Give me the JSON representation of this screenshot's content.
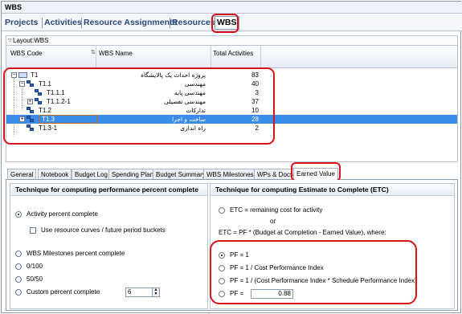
{
  "window": {
    "title": "WBS"
  },
  "top_tabs": [
    {
      "label": "Projects"
    },
    {
      "label": "Activities"
    },
    {
      "label": "Resource Assignments"
    },
    {
      "label": "Resources"
    },
    {
      "label": "WBS"
    }
  ],
  "layout": {
    "label": "Layout:WBS"
  },
  "grid": {
    "columns": [
      "WBS Code",
      "WBS Name",
      "Total Activities"
    ],
    "rows": [
      {
        "code": "T1",
        "name": "پروژه احداث یک پالایشگاه",
        "total": "83"
      },
      {
        "code": "T1.1",
        "name": "مهندسی",
        "total": "40"
      },
      {
        "code": "T1.1.1",
        "name": "مهندسی پایه",
        "total": "3"
      },
      {
        "code": "T1.1.2-1",
        "name": "مهندسی تفصیلی",
        "total": "37"
      },
      {
        "code": "T1.2",
        "name": "تدارکات",
        "total": "10"
      },
      {
        "code": "T1.3",
        "name": "ساخت و اجرا",
        "total": "28"
      },
      {
        "code": "T1.3-1",
        "name": "راه اندازی",
        "total": "2"
      }
    ]
  },
  "bottom_tabs": [
    {
      "label": "General"
    },
    {
      "label": "Notebook"
    },
    {
      "label": "Budget Log"
    },
    {
      "label": "Spending Plan"
    },
    {
      "label": "Budget Summary"
    },
    {
      "label": "WBS Milestones"
    },
    {
      "label": "WPs & Docs"
    },
    {
      "label": "Earned Value"
    }
  ],
  "left_section": {
    "title": "Technique for computing performance percent complete",
    "activity_percent": "Activity percent complete",
    "use_resource_curves": "Use resource curves / future period buckets",
    "wbs_milestones": "WBS Milestones percent complete",
    "opt_0_100": "0/100",
    "opt_50_50": "50/50",
    "custom_percent": "Custom percent complete",
    "custom_value": "6"
  },
  "right_section": {
    "title": "Technique for computing Estimate to Complete (ETC)",
    "etc_remaining": "ETC = remaining cost for activity",
    "or": "or",
    "etc_formula": "ETC = PF * (Budget at Completion - Earned Value), where:",
    "pf_1": "PF = 1",
    "pf_cpi": "PF = 1 / Cost Performance Index",
    "pf_cpi_spi": "PF = 1 / (Cost Performance Index * Schedule Performance Index)",
    "pf_custom": "PF =",
    "pf_value": "0.88"
  },
  "colors": {
    "highlight": "#d8141b",
    "selected_row": "#3b8be8",
    "tab_text": "#2a4a7a"
  }
}
